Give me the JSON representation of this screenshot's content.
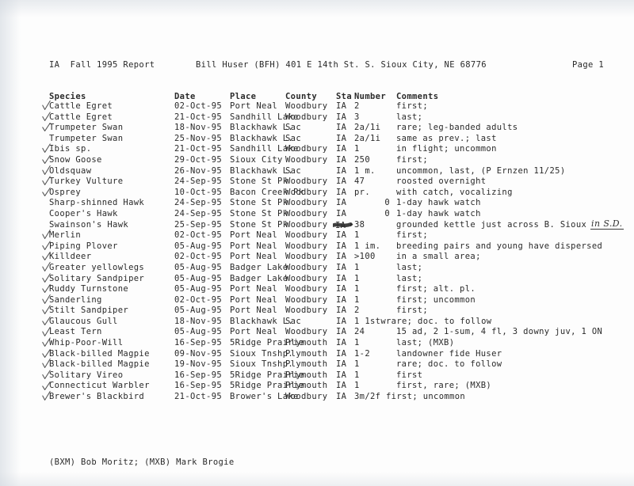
{
  "document": {
    "title": "IA  Fall 1995 Report",
    "address": "Bill Huser (BFH) 401 E 14th St. S. Sioux City, NE 68776",
    "page_label": "Page 1",
    "footer": "(BXM) Bob Moritz; (MXB) Mark Brogie"
  },
  "table": {
    "columns": {
      "species": "Species",
      "date": "Date",
      "place": "Place",
      "county": "County",
      "sta": "Sta",
      "number": "Number",
      "comments": "Comments"
    },
    "rows": [
      {
        "species": "Cattle Egret",
        "date": "02-Oct-95",
        "place": "Port Neal",
        "county": "Woodbury",
        "sta": "IA",
        "number": "2",
        "comments": "first;",
        "check": true
      },
      {
        "species": "Cattle Egret",
        "date": "21-Oct-95",
        "place": "Sandhill Lake",
        "county": "Woodbury",
        "sta": "IA",
        "number": "3",
        "comments": "last;",
        "check": true
      },
      {
        "species": "Trumpeter Swan",
        "date": "18-Nov-95",
        "place": "Blackhawk L.",
        "county": "Sac",
        "sta": "IA",
        "number": "2a/1i",
        "comments": "rare; leg-banded adults",
        "check": true
      },
      {
        "species": "Trumpeter Swan",
        "date": "25-Nov-95",
        "place": "Blackhawk L.",
        "county": "Sac",
        "sta": "IA",
        "number": "2a/1i",
        "comments": "same as prev.; last",
        "check": false
      },
      {
        "species": "Ibis sp.",
        "date": "21-Oct-95",
        "place": "Sandhill Lake",
        "county": "Woodbury",
        "sta": "IA",
        "number": "1",
        "comments": "in flight; uncommon",
        "check": true
      },
      {
        "species": "Snow Goose",
        "date": "29-Oct-95",
        "place": "Sioux City",
        "county": "Woodbury",
        "sta": "IA",
        "number": "250",
        "comments": "first;",
        "check": true
      },
      {
        "species": "Oldsquaw",
        "date": "26-Nov-95",
        "place": "Blackhawk L.",
        "county": "Sac",
        "sta": "IA",
        "number": "1 m.",
        "comments": "uncommon, last, (P Ernzen 11/25)",
        "check": true
      },
      {
        "species": "Turkey Vulture",
        "date": "24-Sep-95",
        "place": "Stone St Pk",
        "county": "Woodbury",
        "sta": "IA",
        "number": "47",
        "comments": "roosted overnight",
        "check": true
      },
      {
        "species": "Osprey",
        "date": "10-Oct-95",
        "place": "Bacon Creek Pk",
        "county": "Woodbury",
        "sta": "IA",
        "number": "pr.",
        "comments": "with catch, vocalizing",
        "check": true
      },
      {
        "species": "Sharp-shinned Hawk",
        "date": "24-Sep-95",
        "place": "Stone St Pk",
        "county": "Woodbury",
        "sta": "IA",
        "number": "0",
        "number_right": true,
        "comments": "1-day hawk watch",
        "check": false
      },
      {
        "species": "Cooper's Hawk",
        "date": "24-Sep-95",
        "place": "Stone St Pk",
        "county": "Woodbury",
        "sta": "IA",
        "number": "0",
        "number_right": true,
        "comments": "1-day hawk watch",
        "check": false
      },
      {
        "species": "Swainson's Hawk",
        "date": "25-Sep-95",
        "place": "Stone St Pk",
        "county": "Woodbury",
        "sta": "IA",
        "sta_struck": true,
        "number": "38",
        "comments": "grounded kettle just across B. Sioux",
        "annotation": "in S.D.",
        "check": false
      },
      {
        "species": "Merlin",
        "date": "02-Oct-95",
        "place": "Port Neal",
        "county": "Woodbury",
        "sta": "IA",
        "number": "1",
        "comments": "first;",
        "check": true
      },
      {
        "species": "Piping Plover",
        "date": "05-Aug-95",
        "place": "Port Neal",
        "county": "Woodbury",
        "sta": "IA",
        "number": "1 im.",
        "comments": "breeding pairs and young have dispersed",
        "check": true
      },
      {
        "species": "Killdeer",
        "date": "02-Oct-95",
        "place": "Port Neal",
        "county": "Woodbury",
        "sta": "IA",
        "number": ">100",
        "comments": "in a small area;",
        "check": true
      },
      {
        "species": "Greater yellowlegs",
        "date": "05-Aug-95",
        "place": "Badger Lake",
        "county": "Woodbury",
        "sta": "IA",
        "number": "1",
        "comments": "last;",
        "check": true
      },
      {
        "species": "Solitary Sandpiper",
        "date": "05-Aug-95",
        "place": "Badger Lake",
        "county": "Woodbury",
        "sta": "IA",
        "number": "1",
        "comments": "last;",
        "check": true
      },
      {
        "species": "Ruddy Turnstone",
        "date": "05-Aug-95",
        "place": "Port Neal",
        "county": "Woodbury",
        "sta": "IA",
        "number": "1",
        "comments": "first; alt. pl.",
        "check": true
      },
      {
        "species": "Sanderling",
        "date": "02-Oct-95",
        "place": "Port Neal",
        "county": "Woodbury",
        "sta": "IA",
        "number": "1",
        "comments": "first; uncommon",
        "check": true
      },
      {
        "species": "Stilt Sandpiper",
        "date": "05-Aug-95",
        "place": "Port Neal",
        "county": "Woodbury",
        "sta": "IA",
        "number": "2",
        "comments": "first;",
        "check": true
      },
      {
        "species": "Glaucous Gull",
        "date": "18-Nov-95",
        "place": "Blackhawk L.",
        "county": "Sac",
        "sta": "IA",
        "number": "1 1stw",
        "comments": "rare; doc. to follow",
        "comments_tight": true,
        "check": true
      },
      {
        "species": "Least Tern",
        "date": "05-Aug-95",
        "place": "Port Neal",
        "county": "Woodbury",
        "sta": "IA",
        "number": "24",
        "comments": "15 ad, 2 1-sum, 4 fl, 3 downy juv, 1 ON",
        "check": true
      },
      {
        "species": "Whip-Poor-Will",
        "date": "16-Sep-95",
        "place": "5Ridge Prairie",
        "county": "Plymouth",
        "sta": "IA",
        "number": "1",
        "comments": "last; (MXB)",
        "check": true
      },
      {
        "species": "Black-billed Magpie",
        "date": "09-Nov-95",
        "place": "Sioux Tnshp.",
        "county": "Plymouth",
        "sta": "IA",
        "number": "1-2",
        "comments": "landowner fide Huser",
        "check": true
      },
      {
        "species": "Black-billed Magpie",
        "date": "19-Nov-95",
        "place": "Sioux Tnshp.",
        "county": "Plymouth",
        "sta": "IA",
        "number": "1",
        "comments": "rare; doc. to follow",
        "check": true
      },
      {
        "species": "Solitary Vireo",
        "date": "16-Sep-95",
        "place": "5Ridge Prairie",
        "county": "Plymouth",
        "sta": "IA",
        "number": "1",
        "comments": "first",
        "check": true
      },
      {
        "species": "Connecticut Warbler",
        "date": "16-Sep-95",
        "place": "5Ridge Prairie",
        "county": "Plymouth",
        "sta": "IA",
        "number": "1",
        "comments": "first, rare; (MXB)",
        "check": true
      },
      {
        "species": "Brewer's Blackbird",
        "date": "21-Oct-95",
        "place": "Brower's Lake",
        "county": "Woodbury",
        "sta": "IA",
        "number": "3m/2f",
        "comments": "first; uncommon",
        "comments_tight": true,
        "check": true
      }
    ]
  }
}
